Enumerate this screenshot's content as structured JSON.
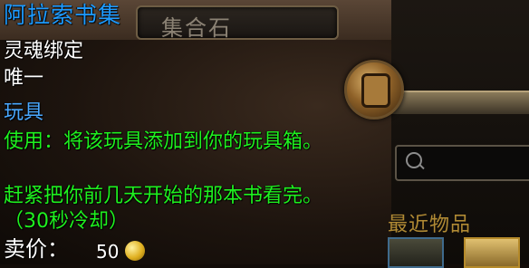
{
  "background_title": "集合石",
  "tooltip": {
    "name": "阿拉索书集",
    "binding": "灵魂绑定",
    "unique": "唯一",
    "type": "玩具",
    "use": "使用：将该玩具添加到你的玩具箱。",
    "flavor": "赶紧把你前几天开始的那本书看完。",
    "cooldown": "（30秒冷却）",
    "sell_label": "卖价：",
    "sell_value": "50"
  },
  "side_panel": {
    "recent_label": "最近物品"
  },
  "colors": {
    "name": "#1e9bff",
    "type": "#4aa8ff",
    "use_text": "#1ff11f",
    "recent_label": "#b08a34"
  },
  "icons": [
    "toy-icon",
    "search-icon",
    "gold-coin-icon"
  ]
}
